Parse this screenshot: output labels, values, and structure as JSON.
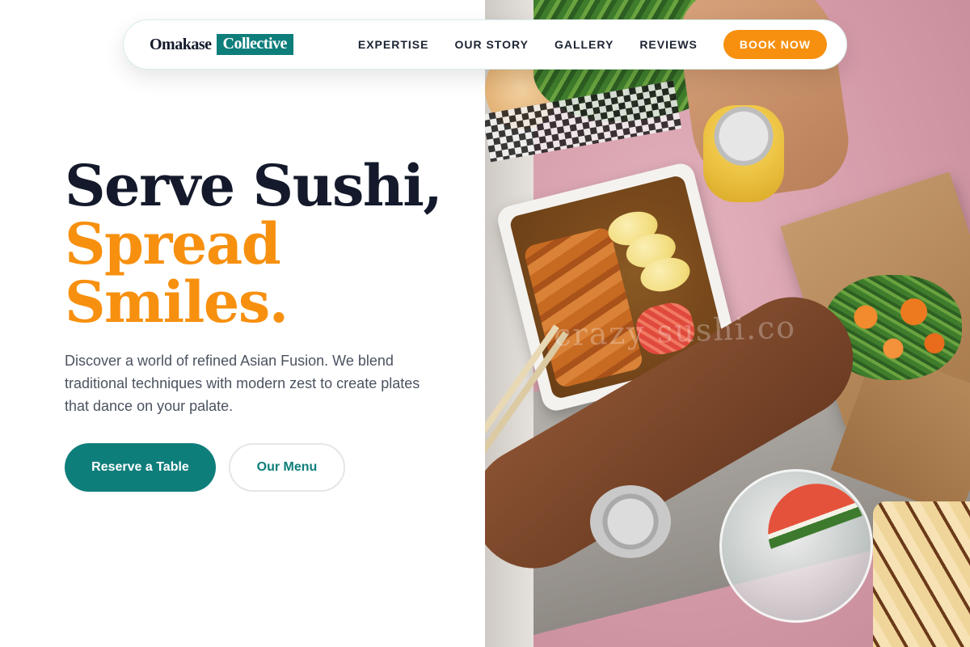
{
  "brand": {
    "name_part1": "Omakase",
    "name_part2": "Collective"
  },
  "nav": {
    "links": [
      "EXPERTISE",
      "OUR STORY",
      "GALLERY",
      "REVIEWS"
    ],
    "cta": "BOOK NOW"
  },
  "hero": {
    "headline_line1": "Serve Sushi,",
    "headline_line2": "Spread",
    "headline_line3": "Smiles.",
    "description": "Discover a world of refined Asian Fusion. We blend traditional techniques with modern zest to create plates that dance on your palate.",
    "primary_button": "Reserve a Table",
    "secondary_button": "Our Menu"
  },
  "photo": {
    "watermark": "crazy sushi.co"
  },
  "colors": {
    "accent_orange": "#f7900f",
    "accent_teal": "#0e7e7b",
    "heading_dark": "#141a2b",
    "body_text": "#4b5360"
  }
}
